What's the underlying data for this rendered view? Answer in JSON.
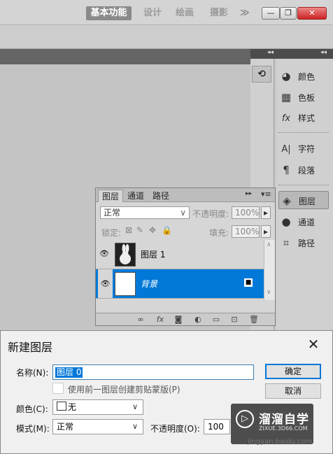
{
  "topbar": {
    "workspaces": [
      "基本功能",
      "设计",
      "绘画",
      "摄影"
    ],
    "more": "≫",
    "window_buttons": {
      "minimize": "—",
      "restore": "❐",
      "close": "✕"
    }
  },
  "dock_left": {
    "item_icon": "history-icon"
  },
  "dock": {
    "items": [
      {
        "icon": "color-icon",
        "glyph": "◕",
        "label": "颜色"
      },
      {
        "icon": "swatches-icon",
        "glyph": "▦",
        "label": "色板"
      },
      {
        "icon": "styles-icon",
        "glyph": "fx",
        "label": "样式"
      },
      {
        "icon": "character-icon",
        "glyph": "A|",
        "label": "字符"
      },
      {
        "icon": "paragraph-icon",
        "glyph": "¶",
        "label": "段落"
      },
      {
        "icon": "layers-icon",
        "glyph": "◈",
        "label": "图层"
      },
      {
        "icon": "channels-icon",
        "glyph": "●",
        "label": "通道"
      },
      {
        "icon": "paths-icon",
        "glyph": "⌗",
        "label": "路径"
      }
    ]
  },
  "layers_panel": {
    "tabs": [
      "图层",
      "通道",
      "路径"
    ],
    "blend_mode": "正常",
    "opacity_label": "不透明度:",
    "opacity_value": "100%",
    "lock_label": "锁定:",
    "fill_label": "填充:",
    "fill_value": "100%",
    "layers": [
      {
        "name": "图层 1",
        "thumb": "rabbit",
        "selected": false
      },
      {
        "name": "背景",
        "thumb": "white",
        "selected": true
      }
    ]
  },
  "dialog": {
    "title": "新建图层",
    "name_label": "名称(N):",
    "name_value": "图层 0",
    "clip_label": "使用前一图层创建剪贴蒙版(P)",
    "color_label": "颜色(C):",
    "color_value": "无",
    "mode_label": "模式(M):",
    "mode_value": "正常",
    "opacity_label": "不透明度(O):",
    "opacity_value": "100",
    "ok_label": "确定",
    "cancel_label": "取消"
  },
  "watermark": {
    "title": "溜溜自学",
    "sub": "ZIXUE.3D66.COM",
    "url": "jingyan.baidu.com"
  },
  "colors": {
    "selection": "#0078d7",
    "dock_bg": "#d0d0d0",
    "canvas": "#c4c4c4"
  }
}
